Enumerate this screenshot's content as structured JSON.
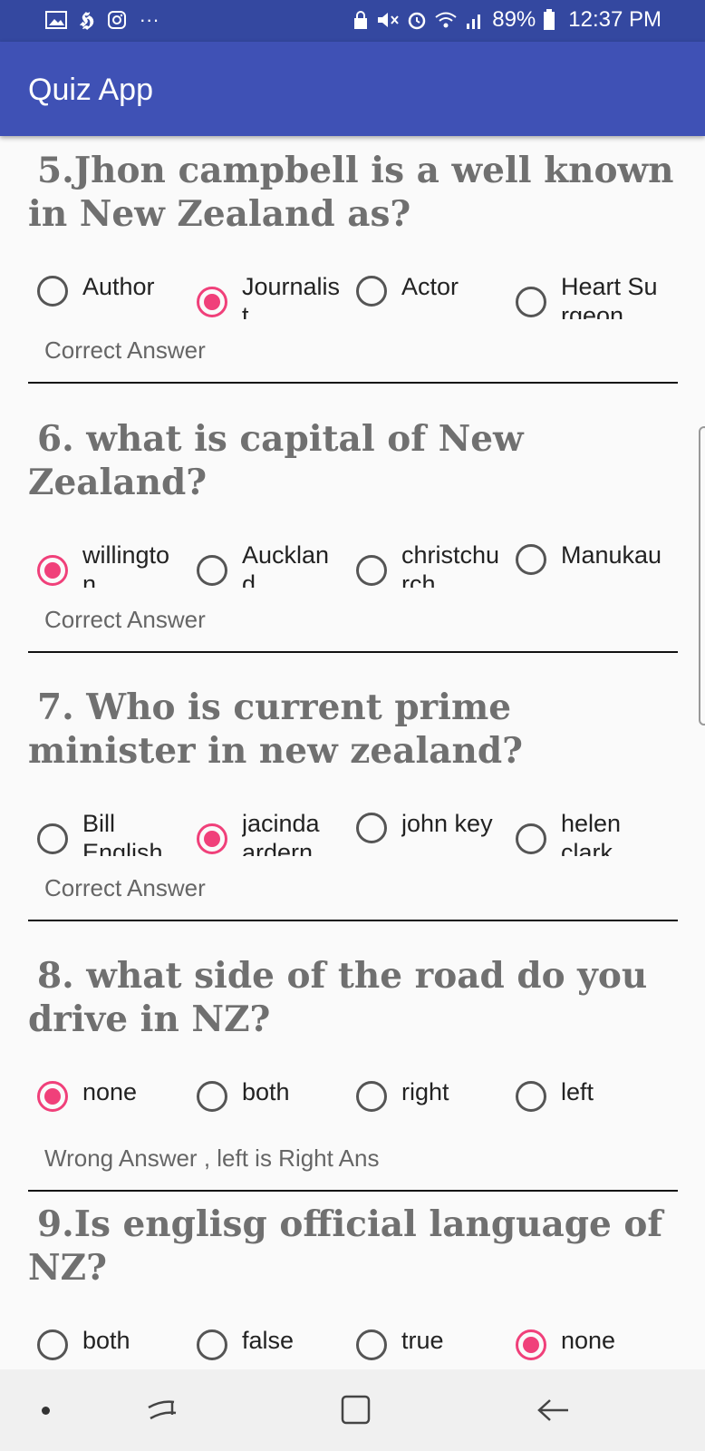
{
  "status_bar": {
    "battery_percent": "89%",
    "time": "12:37 PM",
    "left_icons": [
      "gallery-icon",
      "news-icon",
      "instagram-icon",
      "more-dots-icon"
    ],
    "right_icons": [
      "lock-icon",
      "mute-icon",
      "alarm-icon",
      "wifi-icon",
      "signal-icon",
      "battery-icon"
    ]
  },
  "app_bar": {
    "title": "Quiz App"
  },
  "colors": {
    "app_bar": "#3f51b5",
    "status_bar": "#3448a0",
    "accent": "#f0407a",
    "question_text": "#707070"
  },
  "questions": [
    {
      "title": "5.Jhon campbell is a well known in New Zealand as?",
      "options": [
        "Author",
        "Journalist",
        "Actor",
        "Heart Surgeon"
      ],
      "selected": 1,
      "result": "Correct Answer"
    },
    {
      "title": "6. what is capital of New Zealand?",
      "options": [
        "willington",
        "Auckland",
        "christchurch",
        "Manukau"
      ],
      "selected": 0,
      "result": "Correct Answer"
    },
    {
      "title": "7. Who is current prime minister in new zealand?",
      "options": [
        "Bill English",
        "jacinda ardern",
        "john key",
        "helen clark"
      ],
      "selected": 1,
      "result": "Correct Answer"
    },
    {
      "title": "8. what side of the road do you drive in NZ?",
      "options": [
        "none",
        "both",
        "right",
        "left"
      ],
      "selected": 0,
      "result": "Wrong Answer , left is Right Ans"
    },
    {
      "title": "9.Is englisg official language of NZ?",
      "options": [
        "both",
        "false",
        "true",
        "none"
      ],
      "selected": 3,
      "result": ""
    }
  ],
  "nav_bar": {
    "buttons": [
      "recents-icon",
      "home-icon",
      "back-icon"
    ]
  }
}
